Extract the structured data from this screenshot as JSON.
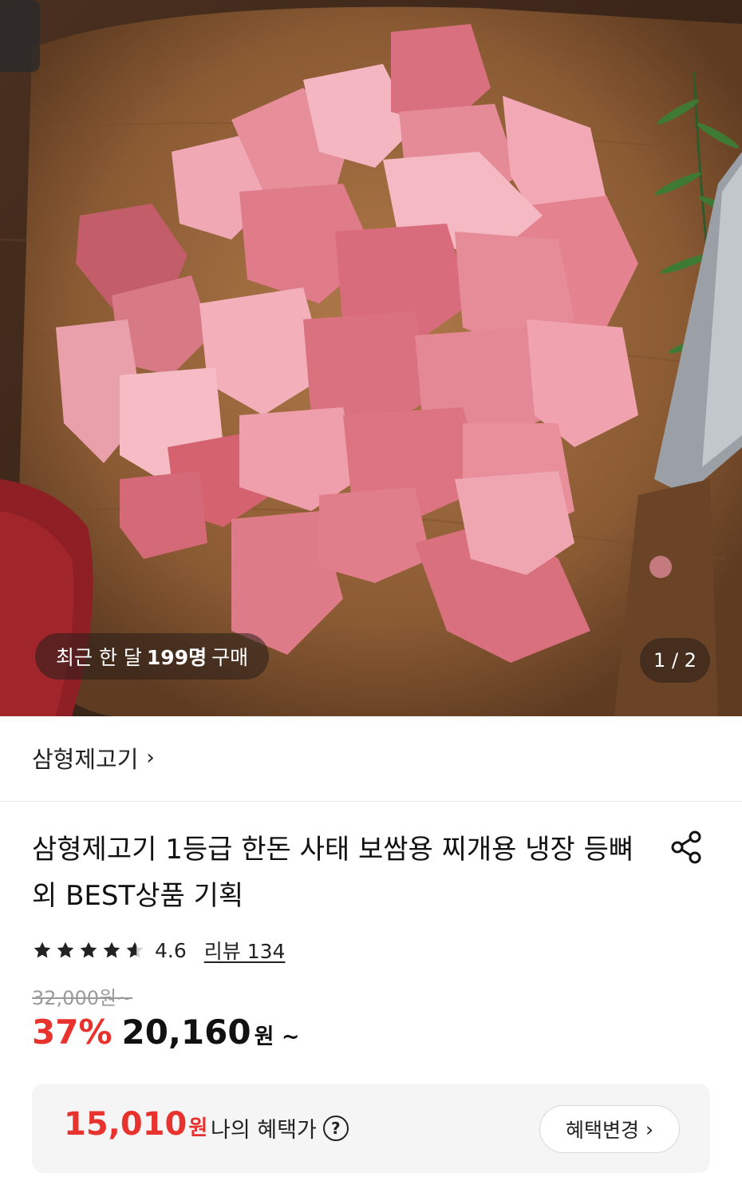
{
  "hero": {
    "recent_prefix": "최근 한 달",
    "recent_count": "199명",
    "recent_suffix": "구매",
    "counter": "1 / 2"
  },
  "brand": {
    "name": "삼형제고기",
    "chevron": "›"
  },
  "product": {
    "title": "삼형제고기 1등급 한돈 사태 보쌈용 찌개용 냉장 등뼈 외 BEST상품 기획",
    "rating": "4.6",
    "rating_stars": 4.6,
    "review_link": "리뷰 134",
    "original_price": "32,000원~",
    "discount": "37%",
    "sale_price": "20,160",
    "sale_suffix": "원 ~"
  },
  "benefit": {
    "price": "15,010",
    "won": "원",
    "label": "나의 혜택가",
    "help": "?",
    "change_button": "혜택변경",
    "change_chevron": "›"
  },
  "icons": {
    "share": "share-icon",
    "star": "star-icon",
    "help": "question-circle-icon"
  },
  "colors": {
    "accent_red": "#e8322d",
    "star": "#222222"
  }
}
